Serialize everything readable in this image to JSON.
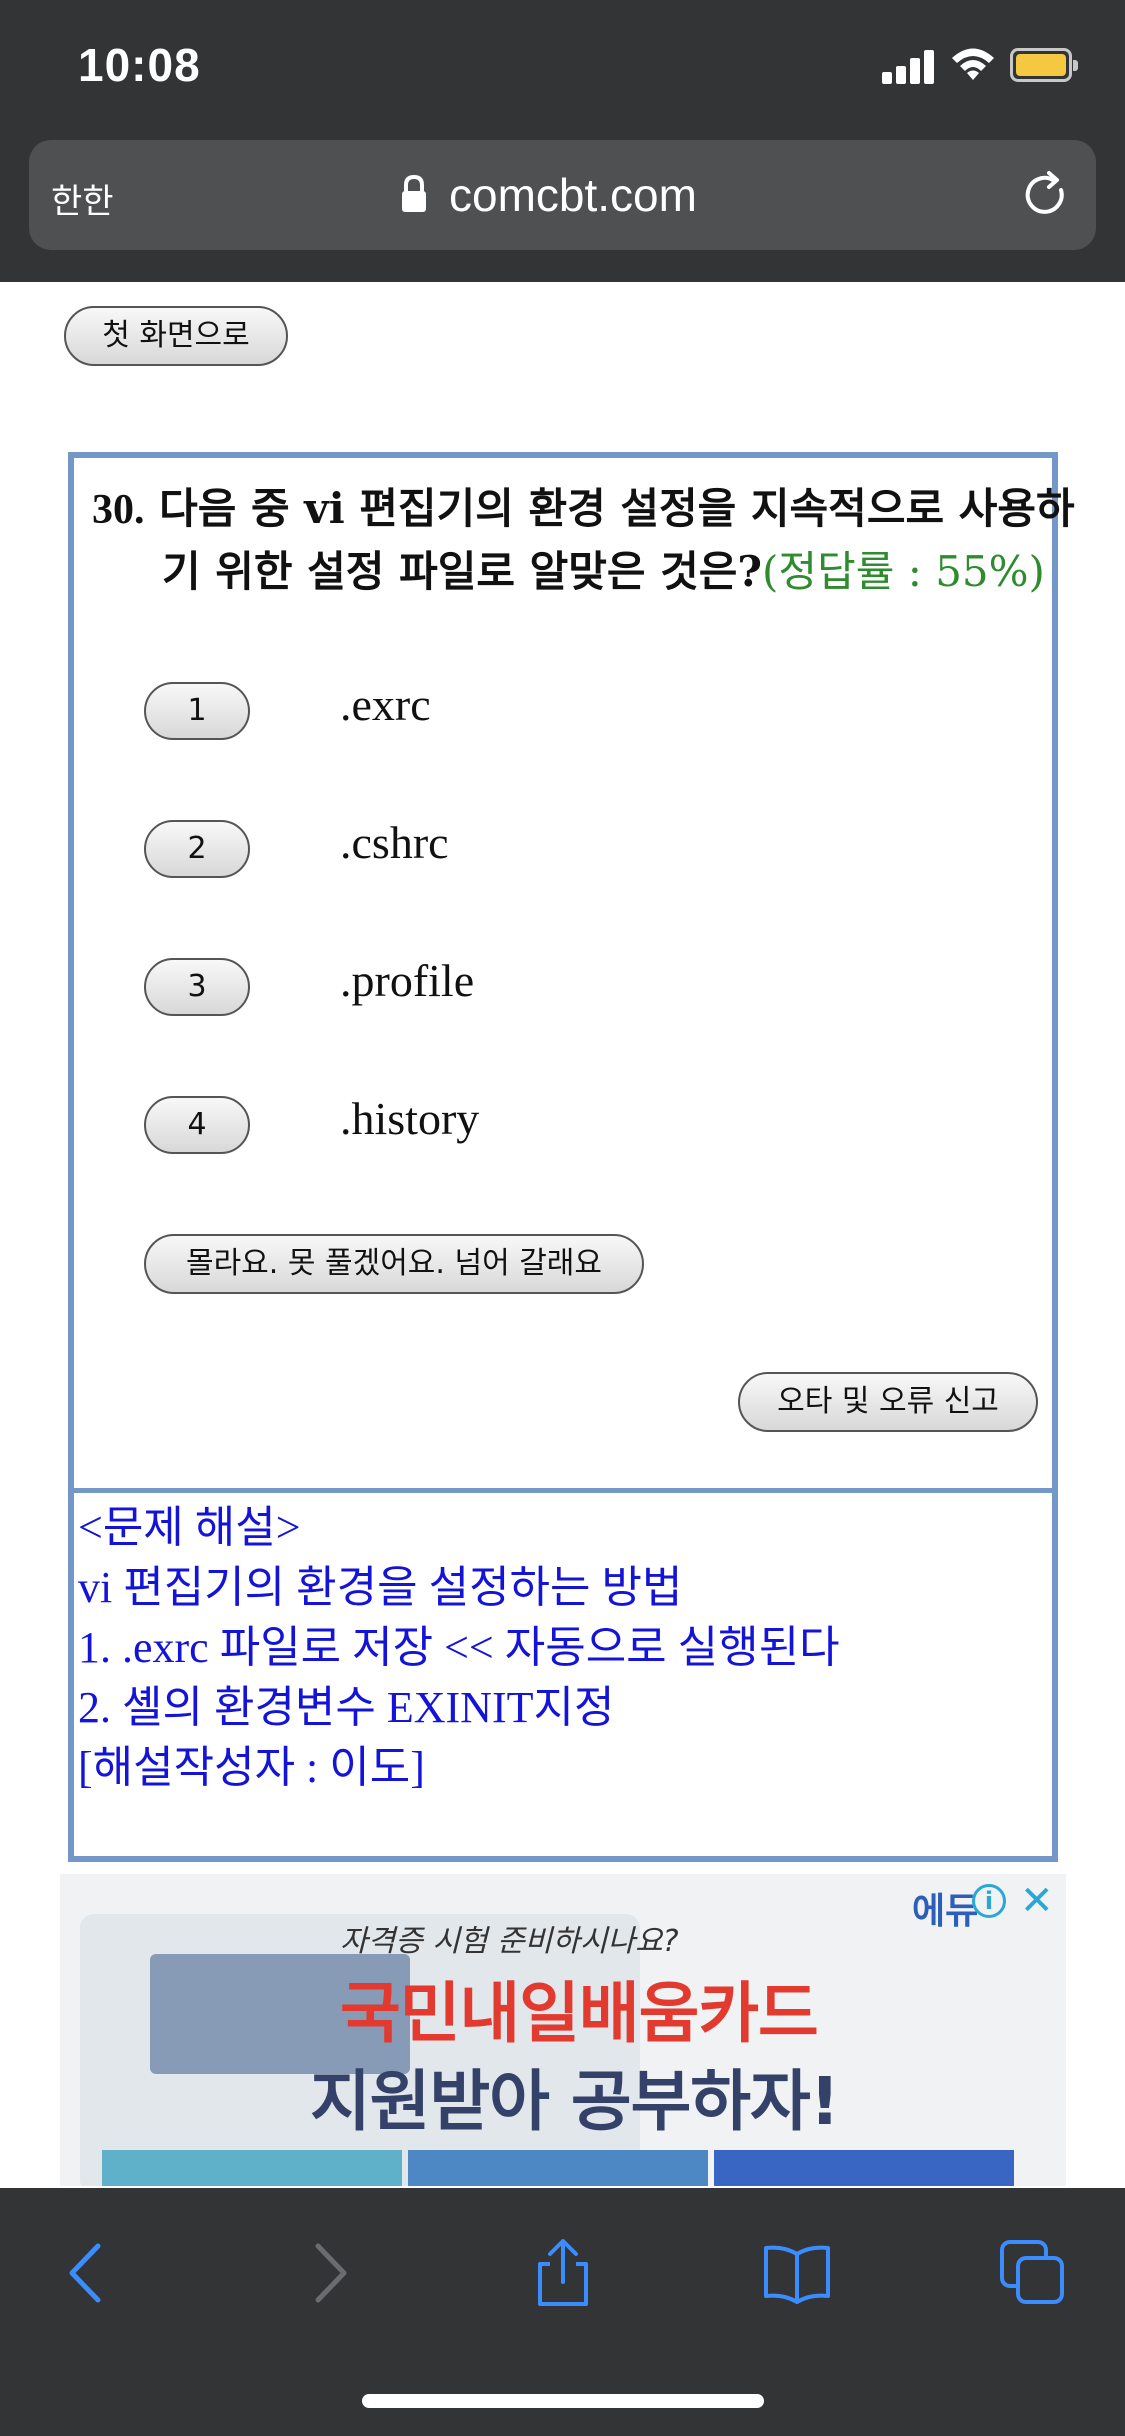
{
  "status": {
    "time": "10:08"
  },
  "browser": {
    "aa_label": "한한",
    "url": "comcbt.com"
  },
  "page": {
    "home_button": "첫 화면으로",
    "question": {
      "number": "30.",
      "text": "다음 중 vi 편집기의 환경 설정을 지속적으로 사용하기 위한 설정 파일로 알맞은 것은?",
      "rate": "(정답률 : 55%)",
      "choices": [
        {
          "num": "1",
          "text": ".exrc"
        },
        {
          "num": "2",
          "text": ".cshrc"
        },
        {
          "num": "3",
          "text": ".profile"
        },
        {
          "num": "4",
          "text": ".history"
        }
      ],
      "skip_button": "몰라요. 못 풀겠어요. 넘어 갈래요",
      "report_button": "오타 및 오류 신고"
    },
    "explanation": {
      "lines": [
        "<문제 해설>",
        "vi 편집기의 환경을 설정하는 방법",
        "1. .exrc 파일로 저장 << 자동으로 실행된다",
        "2. 셸의 환경변수 EXINIT지정",
        "[해설작성자 : 이도]"
      ]
    }
  },
  "ad": {
    "subtitle": "자격증 시험 준비하시나요?",
    "title_red": "국민내일배움카드",
    "title_dark": "지원받아 공부하자!",
    "logo": "에듀",
    "info_label": "i",
    "close_label": "✕"
  },
  "colors": {
    "accent_border": "#7397c7",
    "explanation": "#1414d8",
    "rate": "#2e8b2e",
    "toolbar_icon": "#3b8cff"
  }
}
